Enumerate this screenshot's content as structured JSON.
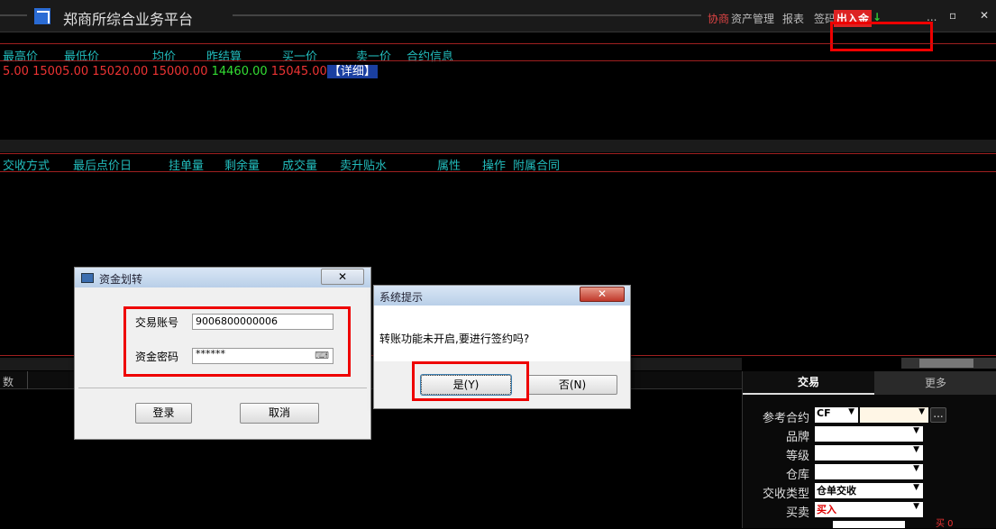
{
  "app": {
    "title": "郑商所综合业务平台",
    "menu": {
      "xieshang": "协商",
      "asset_mgmt": "资产管理",
      "report": "报表",
      "sign": "签码",
      "churujin": "出入金",
      "more": "..."
    },
    "window_buttons": {
      "restore": "▫",
      "close": "✕"
    }
  },
  "quote_table": {
    "headers": [
      "最高价",
      "最低价",
      "均价",
      "昨结算",
      "买一价",
      "卖一价",
      "合约信息"
    ],
    "row": [
      "5.00",
      "15005.00",
      "15020.00",
      "15000.00",
      "14460.00",
      "15045.00",
      "【详细】"
    ]
  },
  "order_table": {
    "headers": [
      "交收方式",
      "最后点价日",
      "挂单量",
      "剩余量",
      "成交量",
      "卖升贴水",
      "属性",
      "操作",
      "附属合同"
    ]
  },
  "lower_left_header": "数",
  "fund_dialog": {
    "title": "资金划转",
    "account_label": "交易账号",
    "account_value": "9006800000006",
    "password_label": "资金密码",
    "password_value": "******",
    "login_label": "登录",
    "cancel_label": "取消",
    "close_glyph": "✕"
  },
  "system_dialog": {
    "title": "系统提示",
    "message": "转账功能未开启,要进行签约吗?",
    "yes_label": "是(Y)",
    "no_label": "否(N)",
    "close_glyph": "✕"
  },
  "trade_panel": {
    "tabs": [
      "交易",
      "更多"
    ],
    "fields": {
      "contract_label": "参考合约",
      "contract_value": "CF",
      "brand_label": "品牌",
      "grade_label": "等级",
      "warehouse_label": "仓库",
      "delivery_label": "交收类型",
      "delivery_value": "仓单交收",
      "side_label": "买卖",
      "side_value": "买入",
      "extra_mark": "买 0"
    },
    "more_glyph": "..."
  },
  "colors": {
    "accent_red": "#dd2222",
    "header_cyan": "#22bbbb",
    "up_red": "#ee3333",
    "down_green": "#33dd33"
  }
}
